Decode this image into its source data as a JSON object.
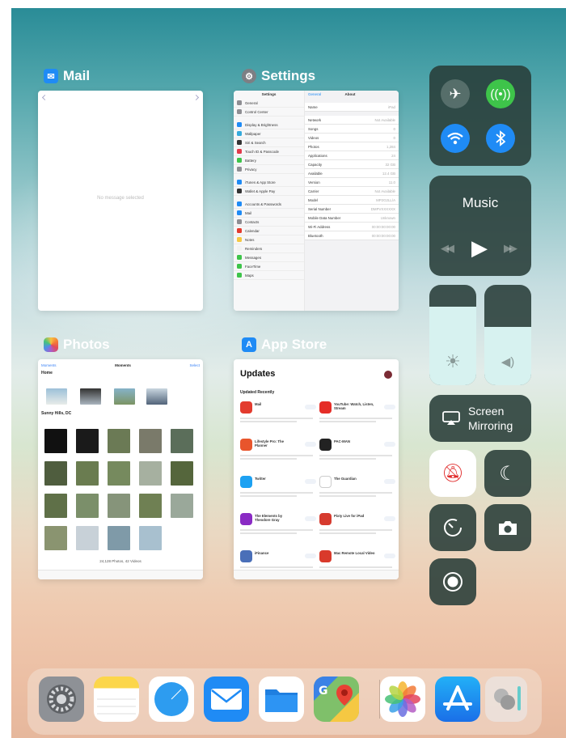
{
  "app_switcher": {
    "cards": {
      "mail": {
        "label": "Mail",
        "empty_message": "No message selected"
      },
      "settings": {
        "label": "Settings",
        "left_header": "Settings",
        "right_back": "General",
        "right_header": "About",
        "left_items": [
          "General",
          "Control Center",
          "Display & Brightness",
          "Wallpaper",
          "Siri & Search",
          "Touch ID & Passcode",
          "Battery",
          "Privacy",
          "iTunes & App Store",
          "Wallet & Apple Pay",
          "Accounts & Passwords",
          "Mail",
          "Contacts",
          "Calendar",
          "Notes",
          "Reminders",
          "Messages",
          "FaceTime",
          "Maps"
        ],
        "right_items": [
          {
            "k": "Name",
            "v": "iPad"
          },
          {
            "k": "Network",
            "v": "Not Available"
          },
          {
            "k": "Songs",
            "v": "0"
          },
          {
            "k": "Videos",
            "v": "0"
          },
          {
            "k": "Photos",
            "v": "1,284"
          },
          {
            "k": "Applications",
            "v": "24"
          },
          {
            "k": "Capacity",
            "v": "32 GB"
          },
          {
            "k": "Available",
            "v": "12.4 GB"
          },
          {
            "k": "Version",
            "v": "11.0"
          },
          {
            "k": "Carrier",
            "v": "Not Available"
          },
          {
            "k": "Model",
            "v": "MP2G2LL/A"
          },
          {
            "k": "Serial Number",
            "v": "DMPVXXXXXX"
          },
          {
            "k": "Mobile Data Number",
            "v": "Unknown"
          },
          {
            "k": "Wi-Fi Address",
            "v": "00:00:00:00:00"
          },
          {
            "k": "Bluetooth",
            "v": "00:00:00:00:00"
          }
        ]
      },
      "photos": {
        "label": "Photos",
        "top_left": "Moments",
        "top_center": "Moments",
        "top_right": "Select",
        "section1": "Home",
        "section2": "Sunny Hills, DC",
        "count": "24,128 Photos, 42 Videos"
      },
      "app_store": {
        "label": "App Store",
        "title": "Updates",
        "subtitle": "Updated Recently",
        "updates": [
          {
            "name": "Mail",
            "color": "#e33b2e"
          },
          {
            "name": "YouTube: Watch, Listen, Stream",
            "color": "#e52d27"
          },
          {
            "name": "Lifestyle Pro: The Planner",
            "color": "#e8552c"
          },
          {
            "name": "PAC-MAN",
            "color": "#222222"
          },
          {
            "name": "Twitter",
            "color": "#1da1f2"
          },
          {
            "name": "The Guardian",
            "color": "#ffffff"
          },
          {
            "name": "The Elements by Theodore Gray",
            "color": "#8a2bc4"
          },
          {
            "name": "Pixty Live for iPad",
            "color": "#d63b2f"
          },
          {
            "name": "iFinance",
            "color": "#4a6fb8"
          },
          {
            "name": "Mac Remote Local Video",
            "color": "#d93a2b"
          }
        ]
      }
    }
  },
  "control_center": {
    "connectivity": {
      "airplane_mode": false,
      "cellular_data": true,
      "wifi": true,
      "bluetooth": true
    },
    "music": {
      "label": "Music"
    },
    "brightness_level": 0.78,
    "volume_level": 0.58,
    "screen_mirroring": {
      "line1": "Screen",
      "line2": "Mirroring"
    },
    "toggles": [
      "mute",
      "do-not-disturb",
      "timer",
      "camera",
      "screen-recording"
    ]
  },
  "dock": {
    "apps": [
      "Settings",
      "Notes",
      "Safari",
      "Mail",
      "Files",
      "Google Maps",
      "Photos",
      "App Store",
      "Recent"
    ]
  },
  "colors": {
    "accent_blue": "#1f8bf5",
    "accent_green": "#3ec44a",
    "mute_red": "#e02a2a"
  }
}
